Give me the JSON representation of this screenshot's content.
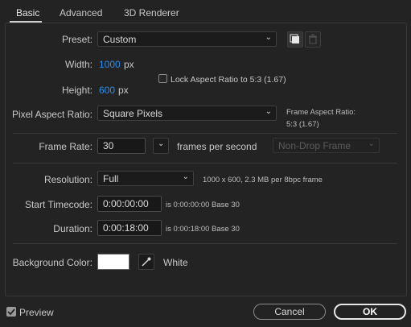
{
  "tabs": [
    {
      "label": "Basic"
    },
    {
      "label": "Advanced"
    },
    {
      "label": "3D Renderer"
    }
  ],
  "preset": {
    "label": "Preset:",
    "value": "Custom"
  },
  "width": {
    "label": "Width:",
    "value": "1000",
    "unit": "px"
  },
  "height": {
    "label": "Height:",
    "value": "600",
    "unit": "px"
  },
  "lock_aspect": {
    "label": "Lock Aspect Ratio to 5:3 (1.67)",
    "checked": false
  },
  "pixel_aspect": {
    "label": "Pixel Aspect Ratio:",
    "value": "Square Pixels"
  },
  "frame_aspect": {
    "label": "Frame Aspect Ratio:",
    "value": "5:3 (1.67)"
  },
  "frame_rate": {
    "label": "Frame Rate:",
    "value": "30",
    "unit": "frames per second",
    "drop_frame": "Non-Drop Frame"
  },
  "resolution": {
    "label": "Resolution:",
    "value": "Full",
    "info": "1000 x 600, 2.3 MB per 8bpc frame"
  },
  "start_timecode": {
    "label": "Start Timecode:",
    "value": "0:00:00:00",
    "info": "is 0:00:00:00  Base 30"
  },
  "duration": {
    "label": "Duration:",
    "value": "0:00:18:00",
    "info": "is 0:00:18:00  Base 30"
  },
  "background": {
    "label": "Background Color:",
    "color": "#ffffff",
    "name": "White"
  },
  "footer": {
    "preview_label": "Preview",
    "preview_checked": true,
    "cancel_label": "Cancel",
    "ok_label": "OK"
  },
  "colors": {
    "accent_blue": "#2d8ceb",
    "bg": "#232323"
  }
}
